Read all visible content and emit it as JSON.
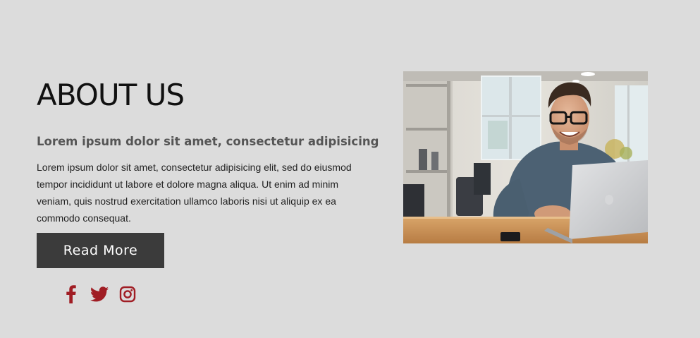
{
  "about": {
    "title": "ABOUT US",
    "subtitle": "Lorem ipsum dolor sit amet, consectetur adipisicing",
    "body": "Lorem ipsum dolor sit amet, consectetur adipisicing elit, sed do eiusmod tempor incididunt ut labore et dolore magna aliqua. Ut enim ad minim veniam, quis nostrud exercitation ullamco laboris nisi ut aliquip ex ea commodo consequat.",
    "button_label": "Read More"
  },
  "social": {
    "icons": [
      "facebook-icon",
      "twitter-icon",
      "instagram-icon"
    ]
  },
  "colors": {
    "background": "#dcdcdc",
    "button": "#3b3b3b",
    "social_accent": "#a01d24"
  }
}
